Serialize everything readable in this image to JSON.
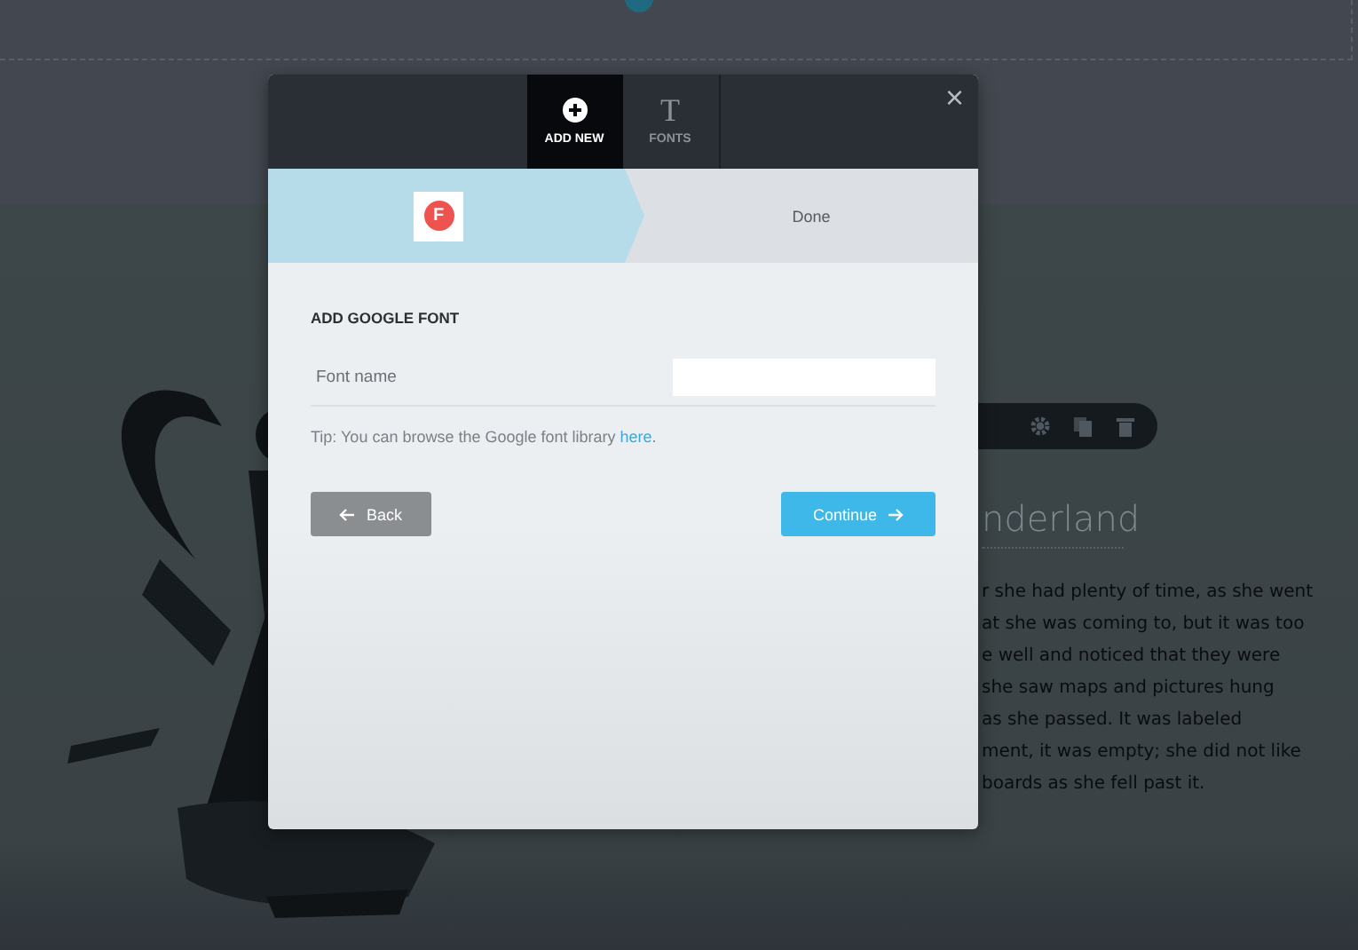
{
  "background": {
    "heading": "nderland",
    "paragraph": [
      "r she had plenty of time, as she went",
      "at she was coming to, but it was too",
      "e well and noticed that they were",
      "she saw maps and pictures hung",
      "as she passed. It was labeled",
      "ment, it was empty; she did not like",
      "boards as she fell past it."
    ]
  },
  "dialog": {
    "tabs": [
      {
        "label": "ADD NEW",
        "selected": true
      },
      {
        "label": "FONTS",
        "glyph": "T",
        "selected": false
      }
    ],
    "close": "×",
    "steps": [
      {
        "badge": "F",
        "selected": true
      },
      {
        "label": "Done",
        "selected": false
      }
    ],
    "heading": "ADD GOOGLE FONT",
    "field": {
      "label": "Font name"
    },
    "tip": {
      "text": "Tip: You can browse the Google font library ",
      "link": "here",
      "end": "."
    },
    "buttons": [
      {
        "kind": "back",
        "label": "Back"
      },
      {
        "kind": "continue",
        "label": "Continue"
      }
    ]
  }
}
